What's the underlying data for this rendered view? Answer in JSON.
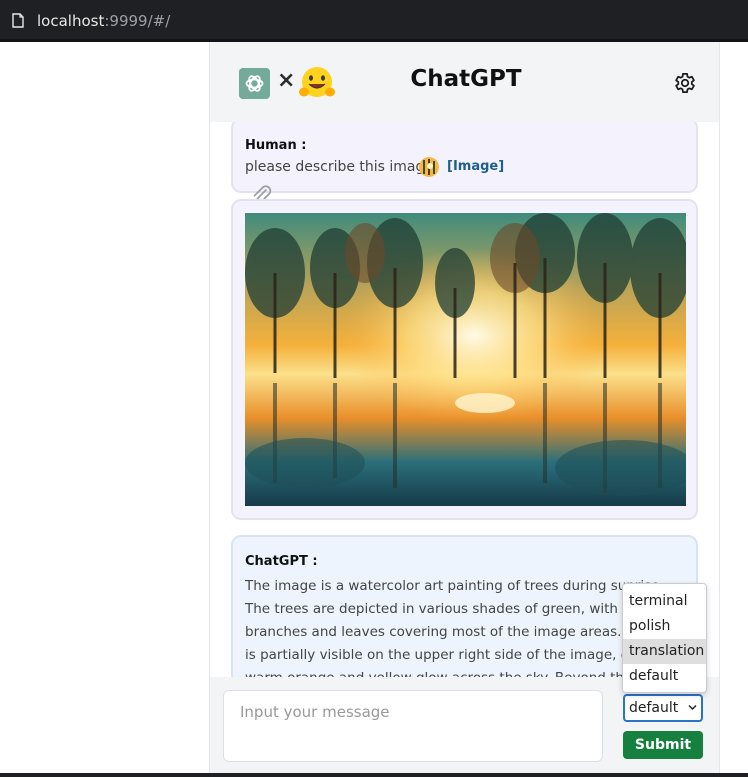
{
  "browser": {
    "url_host": "localhost",
    "url_rest": ":9999/#/"
  },
  "header": {
    "title": "ChatGPT",
    "separator": "×",
    "icons": [
      "openai-logo",
      "hugging-face-emoji",
      "gear-icon"
    ]
  },
  "messages": {
    "human": {
      "sender": "Human :",
      "text": "please describe this image",
      "image_link": "[Image]"
    },
    "assistant": {
      "sender": "ChatGPT :",
      "text": "The image is a watercolor art painting of trees during sunrise. The trees are depicted in various shades of green, with their branches and leaves covering most of the image areas. The sun is partially visible on the upper right side of the image, casting a warm orange and yellow glow across the sky. Beyond the trees in the background"
    }
  },
  "input": {
    "placeholder": "Input your message"
  },
  "mode_select": {
    "selected": "default",
    "options": [
      "terminal",
      "polish",
      "translation",
      "default"
    ],
    "hovered": "translation"
  },
  "submit_label": "Submit",
  "colors": {
    "accent": "#16813e",
    "select_border": "#2a73c9",
    "link": "#1f5f8b"
  }
}
